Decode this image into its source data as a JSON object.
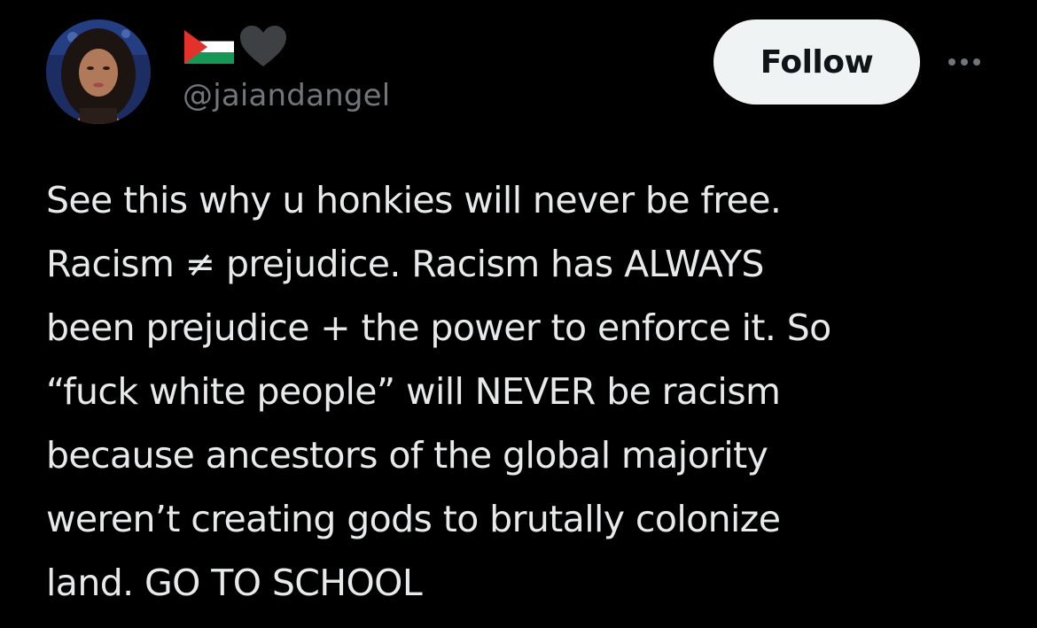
{
  "post": {
    "author": {
      "display_name_icons": [
        "palestine-flag-icon",
        "black-heart-icon"
      ],
      "handle": "@jaiandangel",
      "avatar": "profile-photo"
    },
    "follow_label": "Follow",
    "more_icon": "more-options-icon",
    "text_lines": [
      "See this why u honkies will never be free.",
      "Racism ≠ prejudice. Racism has ALWAYS",
      "been prejudice + the power to enforce it. So",
      "“fuck white people” will NEVER be racism",
      "because ancestors of the global majority",
      "weren’t creating gods to brutally colonize",
      "land. GO TO SCHOOL"
    ]
  },
  "colors": {
    "background": "#000000",
    "text_primary": "#e7e9ea",
    "text_secondary": "#71767b",
    "follow_button_bg": "#eff3f4",
    "follow_button_text": "#0f1419",
    "flag_red": "#e4312b",
    "flag_green": "#149954",
    "heart": "#3e4144"
  }
}
